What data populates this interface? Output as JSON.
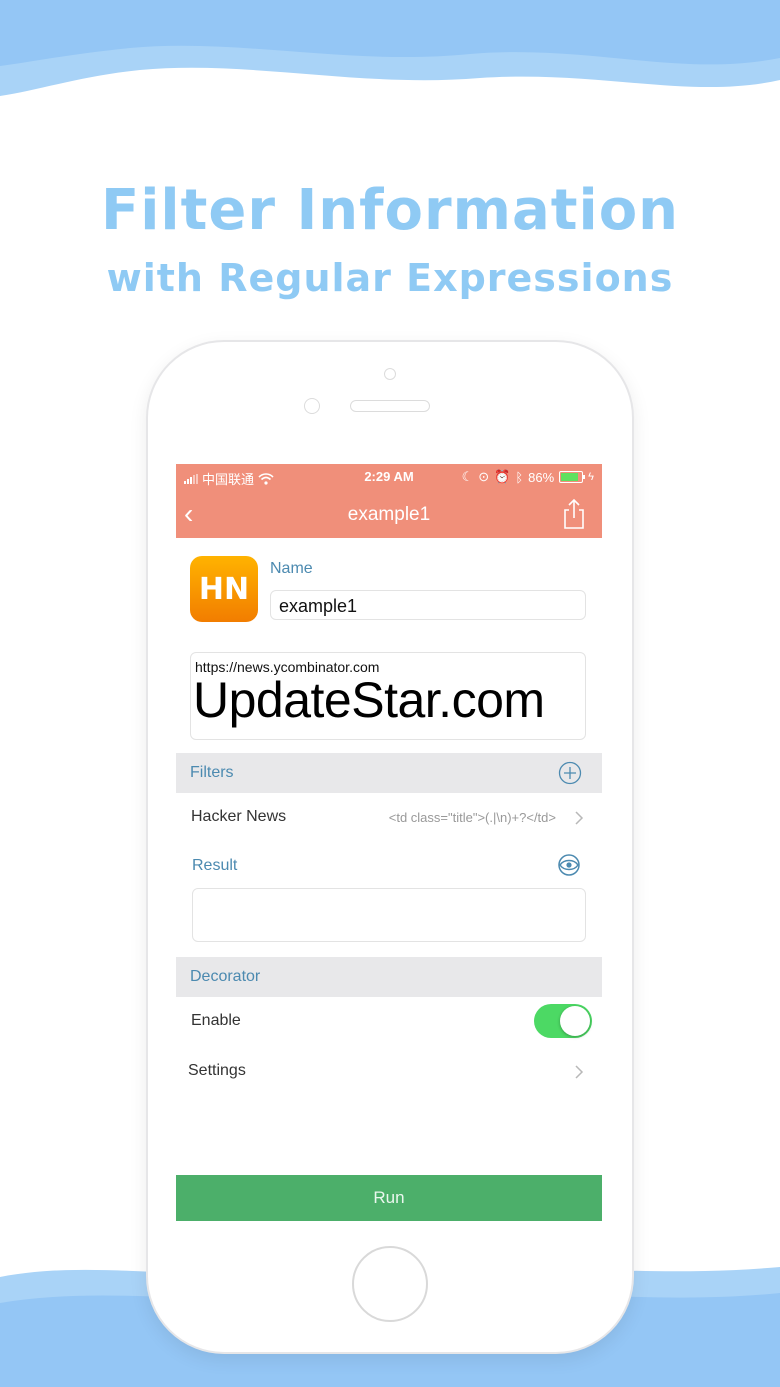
{
  "headline": {
    "line1": "Filter Information",
    "line2": "with  Regular Expressions"
  },
  "status_bar": {
    "carrier": "中国联通",
    "time": "2:29 AM",
    "battery": "86%",
    "battery_level": 0.86
  },
  "nav": {
    "title": "example1",
    "back_icon": "chevron-left-icon",
    "share_icon": "share-icon"
  },
  "app_icon": {
    "text": "HN"
  },
  "name_field": {
    "label": "Name",
    "value": "example1"
  },
  "url_field": {
    "value": "https://news.ycombinator.com"
  },
  "watermark": {
    "text": "UpdateStar.com"
  },
  "filters": {
    "section_label": "Filters",
    "items": [
      {
        "name": "Hacker News",
        "pattern": "<td class=\"title\">(.|\\n)+?</td>"
      }
    ]
  },
  "result": {
    "label": "Result"
  },
  "decorator": {
    "section_label": "Decorator",
    "enable_label": "Enable",
    "enabled": true,
    "settings_label": "Settings"
  },
  "run_button": {
    "label": "Run"
  },
  "colors": {
    "accent": "#f08f7a",
    "run": "#4caf6a",
    "toggle_on": "#4cd964",
    "label_blue": "#4c8ab0",
    "headline": "#8fcaf4"
  }
}
